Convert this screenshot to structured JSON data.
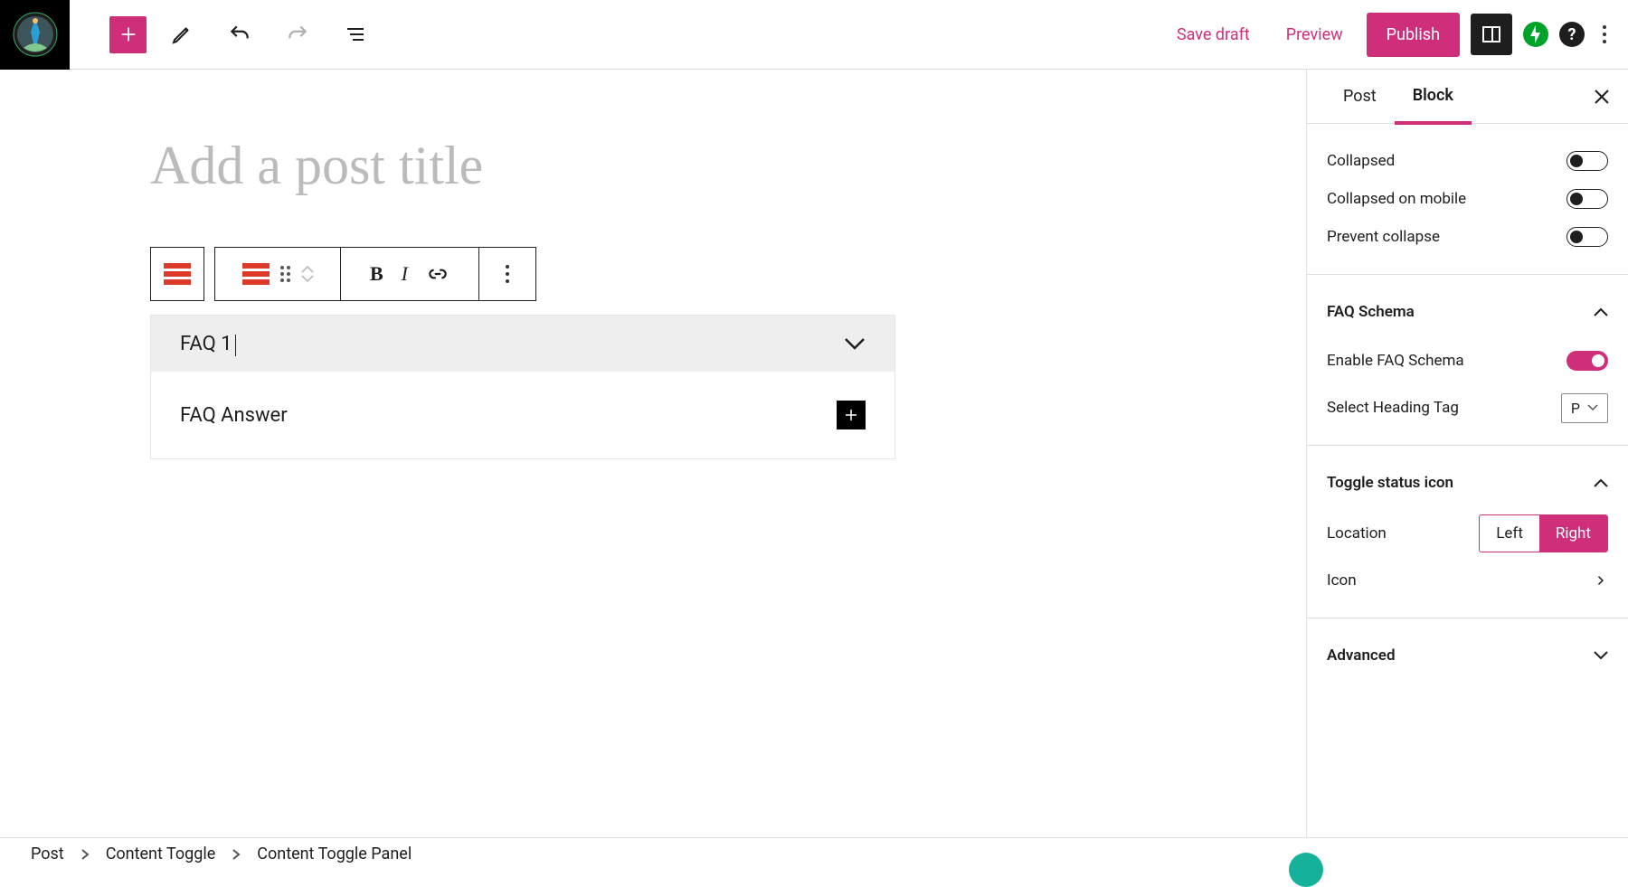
{
  "topbar": {
    "save_draft": "Save draft",
    "preview": "Preview",
    "publish": "Publish"
  },
  "editor": {
    "title_placeholder": "Add a post title",
    "toolbar": {
      "bold": "B",
      "italic": "I"
    },
    "faq": {
      "title": "FAQ 1",
      "answer": "FAQ Answer"
    }
  },
  "sidebar": {
    "tabs": {
      "post": "Post",
      "block": "Block"
    },
    "toggles": {
      "collapsed": "Collapsed",
      "collapsed_mobile": "Collapsed on mobile",
      "prevent_collapse": "Prevent collapse"
    },
    "faq_schema": {
      "heading": "FAQ Schema",
      "enable": "Enable FAQ Schema",
      "select_heading": "Select Heading Tag",
      "heading_value": "P"
    },
    "toggle_status": {
      "heading": "Toggle status icon",
      "location": "Location",
      "left": "Left",
      "right": "Right",
      "icon": "Icon"
    },
    "advanced": "Advanced"
  },
  "breadcrumbs": {
    "a": "Post",
    "b": "Content Toggle",
    "c": "Content Toggle Panel"
  },
  "colors": {
    "accent": "#cf2e7a",
    "red": "#dd3a2b",
    "green": "#00a32a",
    "teal": "#16b19b"
  }
}
